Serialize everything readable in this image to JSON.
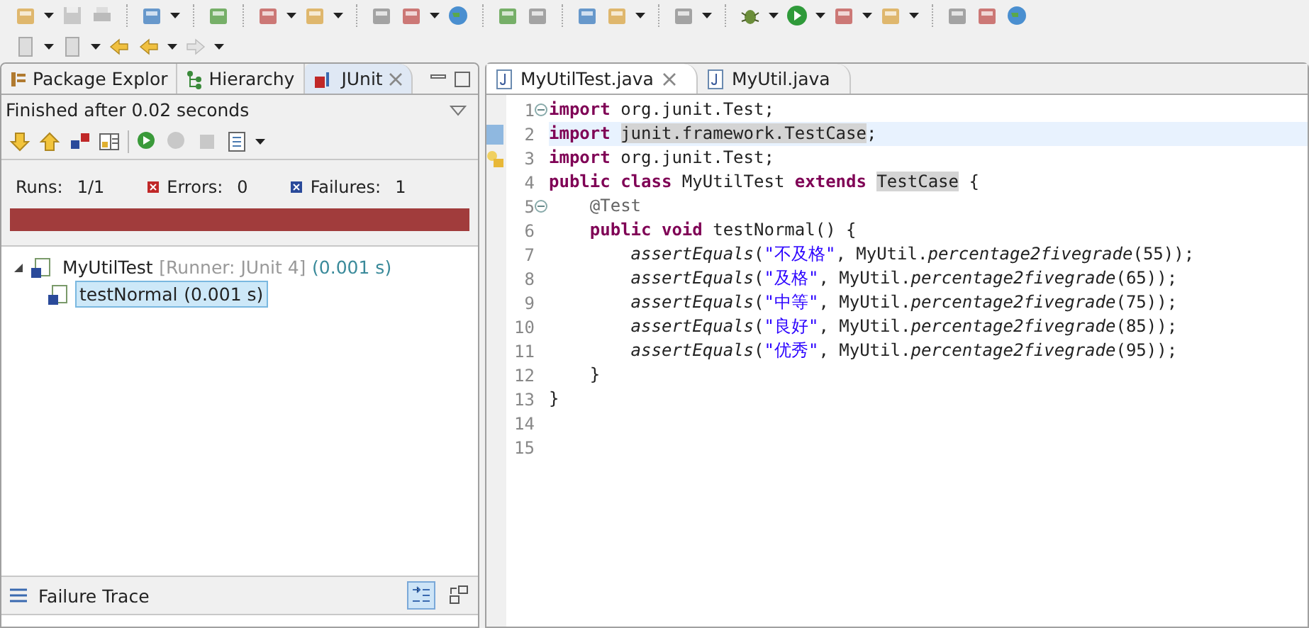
{
  "left_panel": {
    "tabs": [
      {
        "label": "Package Explor",
        "selected": false,
        "closable": false
      },
      {
        "label": "Hierarchy",
        "selected": false,
        "closable": false
      },
      {
        "label": "JUnit",
        "selected": true,
        "closable": true
      }
    ],
    "status": "Finished after 0.02 seconds",
    "counters": [
      {
        "kind": "runs",
        "label": "Runs:",
        "value": "1/1"
      },
      {
        "kind": "errors",
        "label": "Errors:",
        "value": "0"
      },
      {
        "kind": "failures",
        "label": "Failures:",
        "value": "1"
      }
    ],
    "progress": {
      "failed": true,
      "level": 1
    },
    "tree": [
      {
        "name": "MyUtilTest",
        "runner": "[Runner: JUnit 4]",
        "time": "(0.001 s)",
        "selected": false,
        "expanded": true,
        "children": [
          {
            "name": "testNormal",
            "time": "(0.001 s)",
            "selected": true
          }
        ]
      }
    ],
    "failure_trace": {
      "title": "Failure Trace",
      "filter_on": true
    }
  },
  "editor": {
    "tabs": [
      {
        "label": "MyUtilTest.java",
        "selected": true,
        "closable": true
      },
      {
        "label": "MyUtil.java",
        "selected": false,
        "closable": false
      }
    ],
    "lines": [
      {
        "number": "1",
        "kind": "top",
        "fold": true,
        "bookmark": false,
        "warning": false,
        "current": false,
        "tokens": [
          {
            "kind": "kw",
            "text": "import"
          },
          {
            "kind": "plain",
            "text": " org.junit.Test;"
          }
        ]
      },
      {
        "number": "2",
        "kind": "top",
        "fold": false,
        "bookmark": true,
        "warning": false,
        "current": true,
        "tokens": [
          {
            "kind": "kw",
            "text": "import "
          },
          {
            "kind": "hl",
            "text": "junit.framework.TestCase"
          },
          {
            "kind": "plain",
            "text": ";"
          }
        ]
      },
      {
        "number": "3",
        "kind": "top",
        "fold": false,
        "bookmark": false,
        "warning": true,
        "current": false,
        "tokens": [
          {
            "kind": "kw",
            "text": "import"
          },
          {
            "kind": "plain",
            "text": " org.junit.Test;"
          }
        ]
      },
      {
        "number": "4",
        "kind": "top",
        "fold": false,
        "bookmark": false,
        "warning": false,
        "current": false,
        "tokens": [
          {
            "kind": "kw",
            "text": "public class"
          },
          {
            "kind": "plain",
            "text": " MyUtilTest "
          },
          {
            "kind": "kw",
            "text": "extends "
          },
          {
            "kind": "hl",
            "text": "TestCase"
          },
          {
            "kind": "plain",
            "text": " {"
          }
        ]
      },
      {
        "number": "5",
        "kind": "member",
        "fold": true,
        "bookmark": false,
        "warning": false,
        "current": false,
        "tokens": [
          {
            "kind": "ann",
            "text": "@Test"
          }
        ]
      },
      {
        "number": "6",
        "kind": "member",
        "fold": false,
        "bookmark": false,
        "warning": false,
        "current": false,
        "tokens": [
          {
            "kind": "kw",
            "text": "public void"
          },
          {
            "kind": "plain",
            "text": " testNormal() {"
          }
        ]
      },
      {
        "number": "7",
        "kind": "body",
        "fold": false,
        "bookmark": false,
        "warning": false,
        "current": false,
        "tokens": [
          {
            "kind": "it",
            "text": "assertEquals"
          },
          {
            "kind": "plain",
            "text": "("
          },
          {
            "kind": "str",
            "text": "\"不及格\""
          },
          {
            "kind": "plain",
            "text": ", MyUtil."
          },
          {
            "kind": "it",
            "text": "percentage2fivegrade"
          },
          {
            "kind": "plain",
            "text": "(55));"
          }
        ]
      },
      {
        "number": "8",
        "kind": "body",
        "fold": false,
        "bookmark": false,
        "warning": false,
        "current": false,
        "tokens": [
          {
            "kind": "it",
            "text": "assertEquals"
          },
          {
            "kind": "plain",
            "text": "("
          },
          {
            "kind": "str",
            "text": "\"及格\""
          },
          {
            "kind": "plain",
            "text": ", MyUtil."
          },
          {
            "kind": "it",
            "text": "percentage2fivegrade"
          },
          {
            "kind": "plain",
            "text": "(65));"
          }
        ]
      },
      {
        "number": "9",
        "kind": "body",
        "fold": false,
        "bookmark": false,
        "warning": false,
        "current": false,
        "tokens": [
          {
            "kind": "it",
            "text": "assertEquals"
          },
          {
            "kind": "plain",
            "text": "("
          },
          {
            "kind": "str",
            "text": "\"中等\""
          },
          {
            "kind": "plain",
            "text": ", MyUtil."
          },
          {
            "kind": "it",
            "text": "percentage2fivegrade"
          },
          {
            "kind": "plain",
            "text": "(75));"
          }
        ]
      },
      {
        "number": "10",
        "kind": "body",
        "fold": false,
        "bookmark": false,
        "warning": false,
        "current": false,
        "tokens": [
          {
            "kind": "it",
            "text": "assertEquals"
          },
          {
            "kind": "plain",
            "text": "("
          },
          {
            "kind": "str",
            "text": "\"良好\""
          },
          {
            "kind": "plain",
            "text": ", MyUtil."
          },
          {
            "kind": "it",
            "text": "percentage2fivegrade"
          },
          {
            "kind": "plain",
            "text": "(85));"
          }
        ]
      },
      {
        "number": "11",
        "kind": "body",
        "fold": false,
        "bookmark": false,
        "warning": false,
        "current": false,
        "tokens": [
          {
            "kind": "it",
            "text": "assertEquals"
          },
          {
            "kind": "plain",
            "text": "("
          },
          {
            "kind": "str",
            "text": "\"优秀\""
          },
          {
            "kind": "plain",
            "text": ", MyUtil."
          },
          {
            "kind": "it",
            "text": "percentage2fivegrade"
          },
          {
            "kind": "plain",
            "text": "(95));"
          }
        ]
      },
      {
        "number": "12",
        "kind": "member",
        "fold": false,
        "bookmark": false,
        "warning": false,
        "current": false,
        "tokens": [
          {
            "kind": "plain",
            "text": "}"
          }
        ]
      },
      {
        "number": "13",
        "kind": "top",
        "fold": false,
        "bookmark": false,
        "warning": false,
        "current": false,
        "tokens": [
          {
            "kind": "plain",
            "text": "}"
          }
        ]
      },
      {
        "number": "14",
        "fold": false,
        "bookmark": false,
        "warning": false
      },
      {
        "number": "15",
        "fold": false,
        "bookmark": false,
        "warning": false
      }
    ]
  }
}
